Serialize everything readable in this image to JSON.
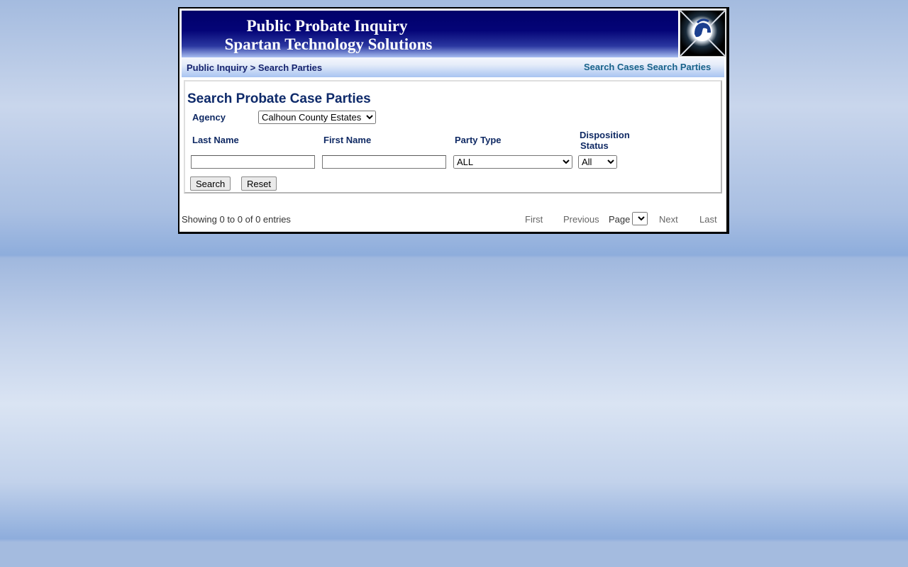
{
  "header": {
    "title_line1": "Public Probate Inquiry",
    "title_line2": "Spartan Technology Solutions",
    "logo_icon": "spartan-helmet-icon"
  },
  "breadcrumb": {
    "root": "Public Inquiry",
    "separator": ">",
    "current": "Search Parties"
  },
  "nav": {
    "search_cases": "Search Cases",
    "search_parties": "Search Parties"
  },
  "form": {
    "title": "Search Probate Case Parties",
    "agency_label": "Agency",
    "agency_selected": "Calhoun County Estates",
    "last_name_label": "Last Name",
    "first_name_label": "First Name",
    "party_type_label": "Party Type",
    "disposition_label_line1": "Disposition",
    "disposition_label_line2": "Status",
    "last_name_value": "",
    "first_name_value": "",
    "party_type_selected": "ALL",
    "disposition_selected": "All",
    "search_button": "Search",
    "reset_button": "Reset"
  },
  "results": {
    "showing": "Showing 0 to 0 of 0 entries",
    "first": "First",
    "previous": "Previous",
    "page_label": "Page",
    "page_selected": "",
    "next": "Next",
    "last": "Last"
  },
  "colors": {
    "banner_dark": "#01016a",
    "heading": "#0e2a6a",
    "nav_link": "#18628a"
  }
}
